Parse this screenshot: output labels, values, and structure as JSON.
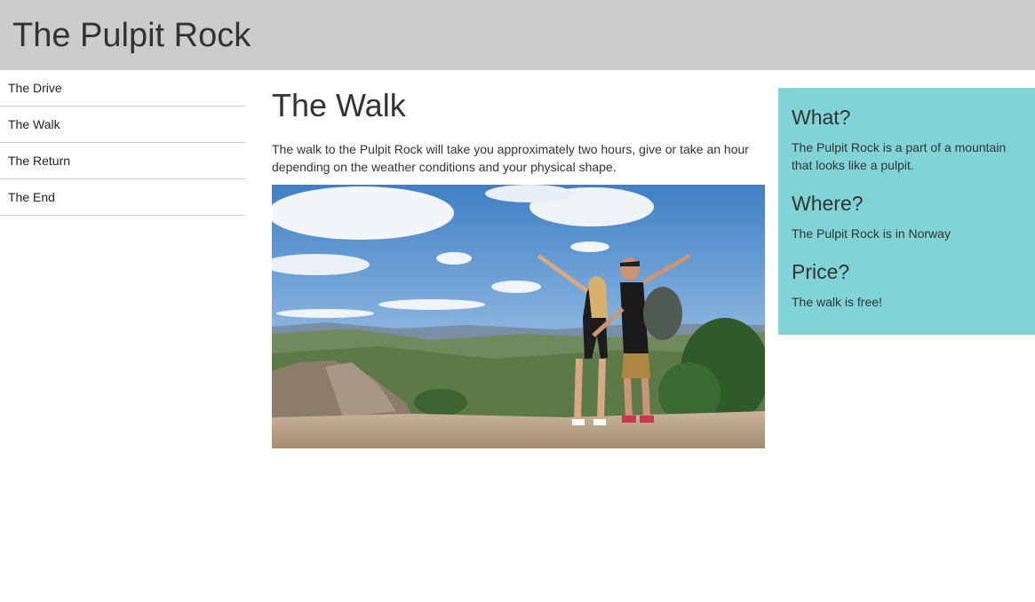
{
  "header": {
    "title": "The Pulpit Rock"
  },
  "nav": {
    "items": [
      {
        "label": "The Drive"
      },
      {
        "label": "The Walk"
      },
      {
        "label": "The Return"
      },
      {
        "label": "The End"
      }
    ]
  },
  "main": {
    "heading": "The Walk",
    "paragraph": "The walk to the Pulpit Rock will take you approximately two hours, give or take an hour depending on the weather conditions and your physical shape."
  },
  "aside": {
    "blocks": [
      {
        "heading": "What?",
        "text": "The Pulpit Rock is a part of a mountain that looks like a pulpit."
      },
      {
        "heading": "Where?",
        "text": "The Pulpit Rock is in Norway"
      },
      {
        "heading": "Price?",
        "text": "The walk is free!"
      }
    ]
  },
  "colors": {
    "header_bg": "#cccccc",
    "aside_bg": "#80d4d6",
    "text": "#333333"
  }
}
